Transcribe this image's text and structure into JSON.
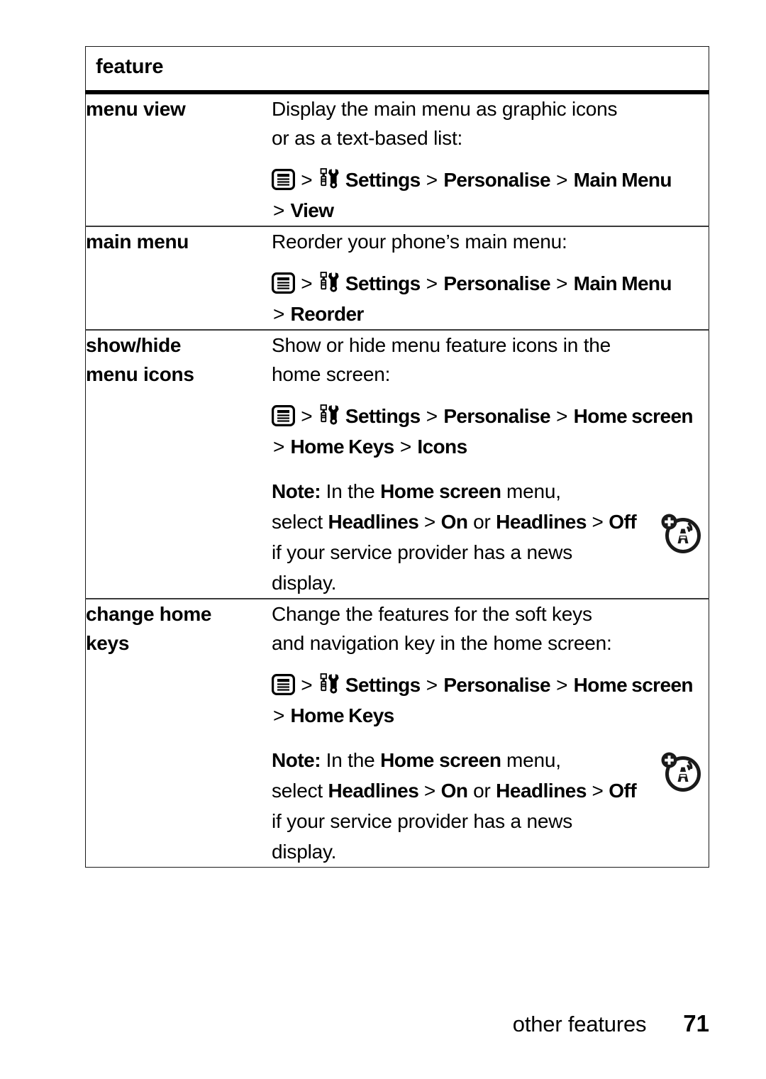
{
  "table": {
    "header": {
      "label": "feature"
    },
    "rows": [
      {
        "name": "menu view",
        "desc_lines": [
          "Display the main menu as graphic icons",
          "or as a text-based list:"
        ],
        "path": {
          "icons": [
            "menu-icon",
            "settings-icon"
          ],
          "segments": [
            "Settings",
            "Personalise",
            "Main Menu",
            "View"
          ],
          "separator": ">"
        },
        "note": null
      },
      {
        "name": "main menu",
        "desc_lines": [
          "Reorder your phone’s main menu:"
        ],
        "path": {
          "icons": [
            "menu-icon",
            "settings-icon"
          ],
          "segments": [
            "Settings",
            "Personalise",
            "Main Menu",
            "Reorder"
          ],
          "separator": ">"
        },
        "note": null
      },
      {
        "name": "show/hide menu icons",
        "name_lines": [
          "show/hide",
          "menu icons"
        ],
        "desc_lines": [
          "Show or hide menu feature icons in the",
          "home screen:"
        ],
        "path": {
          "icons": [
            "menu-icon",
            "settings-icon"
          ],
          "segments": [
            "Settings",
            "Personalise",
            "Home screen",
            "Home Keys",
            "Icons"
          ],
          "separator": ">"
        },
        "note": {
          "label": "Note:",
          "line1_plain_a": " In the ",
          "line1_bold": "Home screen",
          "line1_plain_b": " menu,",
          "line2_plain_a": "select ",
          "line2_bold_a": "Headlines",
          "line2_sep_a": " > ",
          "line2_bold_b": "On",
          "line2_plain_b": " or ",
          "line2_bold_c": "Headlines",
          "line2_sep_b": " > ",
          "line2_bold_d": "Off",
          "line3": "if your service provider has a news",
          "line4": "display.",
          "icon": "service-provider-icon"
        }
      },
      {
        "name": "change home keys",
        "name_lines": [
          "change home",
          "keys"
        ],
        "desc_lines": [
          "Change the features for the soft keys",
          "and navigation key in the home screen:"
        ],
        "path": {
          "icons": [
            "menu-icon",
            "settings-icon"
          ],
          "segments": [
            "Settings",
            "Personalise",
            "Home screen",
            "Home Keys"
          ],
          "separator": ">"
        },
        "note": {
          "label": "Note:",
          "line1_plain_a": " In the ",
          "line1_bold": "Home screen",
          "line1_plain_b": " menu,",
          "line2_plain_a": "select ",
          "line2_bold_a": "Headlines",
          "line2_sep_a": " > ",
          "line2_bold_b": "On",
          "line2_plain_b": " or ",
          "line2_bold_c": "Headlines",
          "line2_sep_b": " > ",
          "line2_bold_d": "Off",
          "line3": "if your service provider has a news",
          "line4": "display.",
          "icon": "service-provider-icon"
        }
      }
    ]
  },
  "footer": {
    "title": "other features",
    "page": "71"
  },
  "colors": {
    "text": "#000000",
    "border": "#1a1a1a",
    "rule": "#3a3a3a",
    "background": "#ffffff"
  }
}
